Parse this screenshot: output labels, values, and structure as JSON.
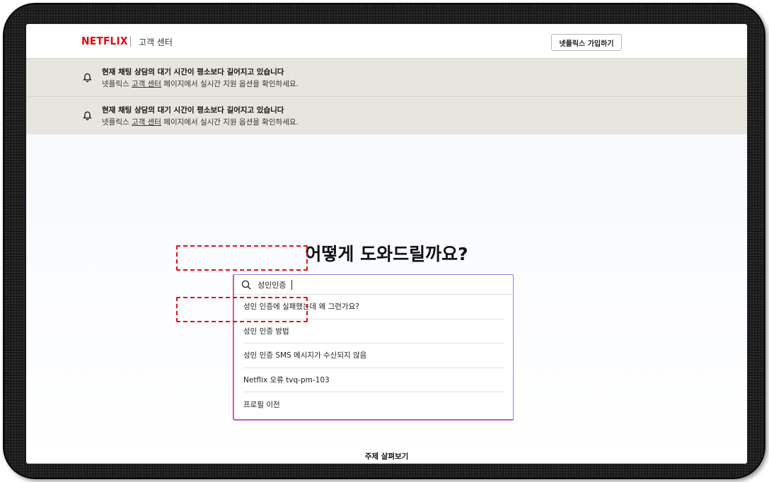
{
  "header": {
    "logo": "NETFLIX",
    "section": "고객 센터",
    "signup_button": "넷플릭스 가입하기"
  },
  "notices": [
    {
      "title": "현재 채팅 상담의 대기 시간이 평소보다 길어지고 있습니다",
      "desc_prefix": "넷플릭스 ",
      "desc_link": "고객 센터",
      "desc_suffix": " 페이지에서 실시간 지원 옵션을 확인하세요.",
      "icon": "bell-icon"
    },
    {
      "title": "현재 채팅 상담의 대기 시간이 평소보다 길어지고 있습니다",
      "desc_prefix": "넷플릭스 ",
      "desc_link": "고객 센터",
      "desc_suffix": " 페이지에서 실시간 지원 옵션을 확인하세요.",
      "icon": "bell-icon"
    }
  ],
  "main": {
    "headline": "어떻게 도와드릴까요?",
    "search": {
      "value": "성인인증",
      "icon": "search-icon"
    },
    "suggestions": [
      "성인 인증에 실패했는데 왜 그런가요?",
      "성인 인증 방법",
      "성인 인증 SMS 메시지가 수신되지 않음",
      "Netflix 오류 tvq-pm-103",
      "프로필 이전"
    ],
    "explore_label": "주제 살펴보기"
  },
  "colors": {
    "brand": "#e50914",
    "notice_bg": "#e6e5e0",
    "annotation": "#e0101a"
  }
}
